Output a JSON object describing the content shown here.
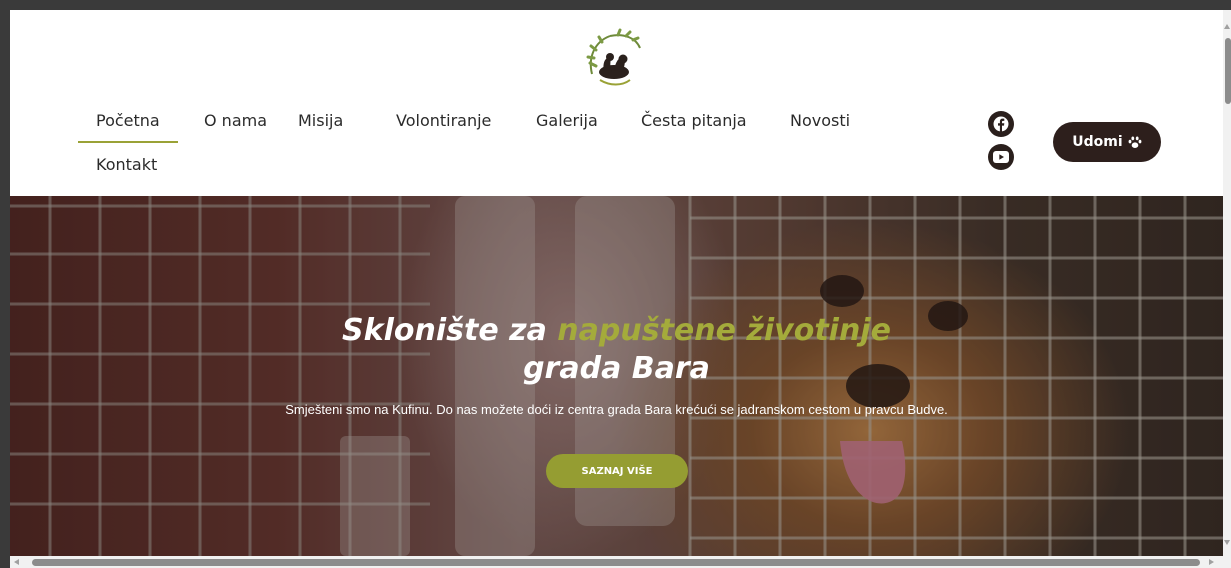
{
  "nav": {
    "items": [
      {
        "label": "Početna",
        "active": true
      },
      {
        "label": "O nama"
      },
      {
        "label": "Misija"
      },
      {
        "label": "Volontiranje"
      },
      {
        "label": "Galerija"
      },
      {
        "label": "Česta pitanja"
      },
      {
        "label": "Novosti"
      },
      {
        "label": "Kontakt"
      }
    ],
    "accent_color": "#9aa236"
  },
  "social": {
    "icons": [
      "facebook-icon",
      "youtube-icon"
    ]
  },
  "cta_header": {
    "label": "Udomi",
    "icon": "paw-icon",
    "color": "#2d1f1c"
  },
  "logo": {
    "icon": "shelter-logo"
  },
  "hero": {
    "title_part1": "Sklonište za",
    "title_accent": "napuštene životinje",
    "title_line2": "grada Bara",
    "subtitle": "Smješteni smo na Kufinu. Do nas možete doći iz centra grada Bara krećući se jadranskom cestom u pravcu Budve.",
    "button_label": "SAZNAJ VIŠE",
    "accent_color": "#a4ab3b"
  }
}
